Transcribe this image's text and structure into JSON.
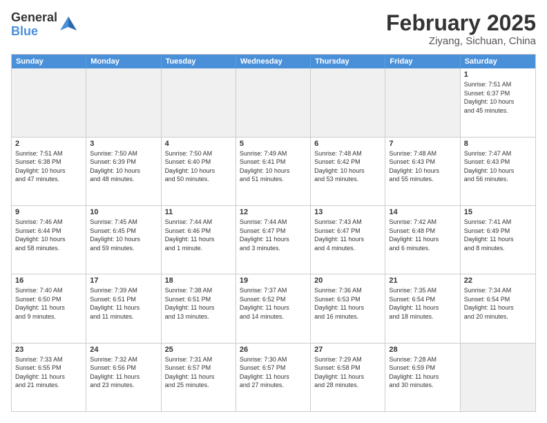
{
  "logo": {
    "general": "General",
    "blue": "Blue"
  },
  "title": "February 2025",
  "location": "Ziyang, Sichuan, China",
  "header_days": [
    "Sunday",
    "Monday",
    "Tuesday",
    "Wednesday",
    "Thursday",
    "Friday",
    "Saturday"
  ],
  "weeks": [
    [
      {
        "day": "",
        "info": "",
        "shaded": true
      },
      {
        "day": "",
        "info": "",
        "shaded": true
      },
      {
        "day": "",
        "info": "",
        "shaded": true
      },
      {
        "day": "",
        "info": "",
        "shaded": true
      },
      {
        "day": "",
        "info": "",
        "shaded": true
      },
      {
        "day": "",
        "info": "",
        "shaded": true
      },
      {
        "day": "1",
        "info": "Sunrise: 7:51 AM\nSunset: 6:37 PM\nDaylight: 10 hours\nand 45 minutes.",
        "shaded": false
      }
    ],
    [
      {
        "day": "2",
        "info": "Sunrise: 7:51 AM\nSunset: 6:38 PM\nDaylight: 10 hours\nand 47 minutes.",
        "shaded": false
      },
      {
        "day": "3",
        "info": "Sunrise: 7:50 AM\nSunset: 6:39 PM\nDaylight: 10 hours\nand 48 minutes.",
        "shaded": false
      },
      {
        "day": "4",
        "info": "Sunrise: 7:50 AM\nSunset: 6:40 PM\nDaylight: 10 hours\nand 50 minutes.",
        "shaded": false
      },
      {
        "day": "5",
        "info": "Sunrise: 7:49 AM\nSunset: 6:41 PM\nDaylight: 10 hours\nand 51 minutes.",
        "shaded": false
      },
      {
        "day": "6",
        "info": "Sunrise: 7:48 AM\nSunset: 6:42 PM\nDaylight: 10 hours\nand 53 minutes.",
        "shaded": false
      },
      {
        "day": "7",
        "info": "Sunrise: 7:48 AM\nSunset: 6:43 PM\nDaylight: 10 hours\nand 55 minutes.",
        "shaded": false
      },
      {
        "day": "8",
        "info": "Sunrise: 7:47 AM\nSunset: 6:43 PM\nDaylight: 10 hours\nand 56 minutes.",
        "shaded": false
      }
    ],
    [
      {
        "day": "9",
        "info": "Sunrise: 7:46 AM\nSunset: 6:44 PM\nDaylight: 10 hours\nand 58 minutes.",
        "shaded": false
      },
      {
        "day": "10",
        "info": "Sunrise: 7:45 AM\nSunset: 6:45 PM\nDaylight: 10 hours\nand 59 minutes.",
        "shaded": false
      },
      {
        "day": "11",
        "info": "Sunrise: 7:44 AM\nSunset: 6:46 PM\nDaylight: 11 hours\nand 1 minute.",
        "shaded": false
      },
      {
        "day": "12",
        "info": "Sunrise: 7:44 AM\nSunset: 6:47 PM\nDaylight: 11 hours\nand 3 minutes.",
        "shaded": false
      },
      {
        "day": "13",
        "info": "Sunrise: 7:43 AM\nSunset: 6:47 PM\nDaylight: 11 hours\nand 4 minutes.",
        "shaded": false
      },
      {
        "day": "14",
        "info": "Sunrise: 7:42 AM\nSunset: 6:48 PM\nDaylight: 11 hours\nand 6 minutes.",
        "shaded": false
      },
      {
        "day": "15",
        "info": "Sunrise: 7:41 AM\nSunset: 6:49 PM\nDaylight: 11 hours\nand 8 minutes.",
        "shaded": false
      }
    ],
    [
      {
        "day": "16",
        "info": "Sunrise: 7:40 AM\nSunset: 6:50 PM\nDaylight: 11 hours\nand 9 minutes.",
        "shaded": false
      },
      {
        "day": "17",
        "info": "Sunrise: 7:39 AM\nSunset: 6:51 PM\nDaylight: 11 hours\nand 11 minutes.",
        "shaded": false
      },
      {
        "day": "18",
        "info": "Sunrise: 7:38 AM\nSunset: 6:51 PM\nDaylight: 11 hours\nand 13 minutes.",
        "shaded": false
      },
      {
        "day": "19",
        "info": "Sunrise: 7:37 AM\nSunset: 6:52 PM\nDaylight: 11 hours\nand 14 minutes.",
        "shaded": false
      },
      {
        "day": "20",
        "info": "Sunrise: 7:36 AM\nSunset: 6:53 PM\nDaylight: 11 hours\nand 16 minutes.",
        "shaded": false
      },
      {
        "day": "21",
        "info": "Sunrise: 7:35 AM\nSunset: 6:54 PM\nDaylight: 11 hours\nand 18 minutes.",
        "shaded": false
      },
      {
        "day": "22",
        "info": "Sunrise: 7:34 AM\nSunset: 6:54 PM\nDaylight: 11 hours\nand 20 minutes.",
        "shaded": false
      }
    ],
    [
      {
        "day": "23",
        "info": "Sunrise: 7:33 AM\nSunset: 6:55 PM\nDaylight: 11 hours\nand 21 minutes.",
        "shaded": false
      },
      {
        "day": "24",
        "info": "Sunrise: 7:32 AM\nSunset: 6:56 PM\nDaylight: 11 hours\nand 23 minutes.",
        "shaded": false
      },
      {
        "day": "25",
        "info": "Sunrise: 7:31 AM\nSunset: 6:57 PM\nDaylight: 11 hours\nand 25 minutes.",
        "shaded": false
      },
      {
        "day": "26",
        "info": "Sunrise: 7:30 AM\nSunset: 6:57 PM\nDaylight: 11 hours\nand 27 minutes.",
        "shaded": false
      },
      {
        "day": "27",
        "info": "Sunrise: 7:29 AM\nSunset: 6:58 PM\nDaylight: 11 hours\nand 28 minutes.",
        "shaded": false
      },
      {
        "day": "28",
        "info": "Sunrise: 7:28 AM\nSunset: 6:59 PM\nDaylight: 11 hours\nand 30 minutes.",
        "shaded": false
      },
      {
        "day": "",
        "info": "",
        "shaded": true
      }
    ]
  ]
}
